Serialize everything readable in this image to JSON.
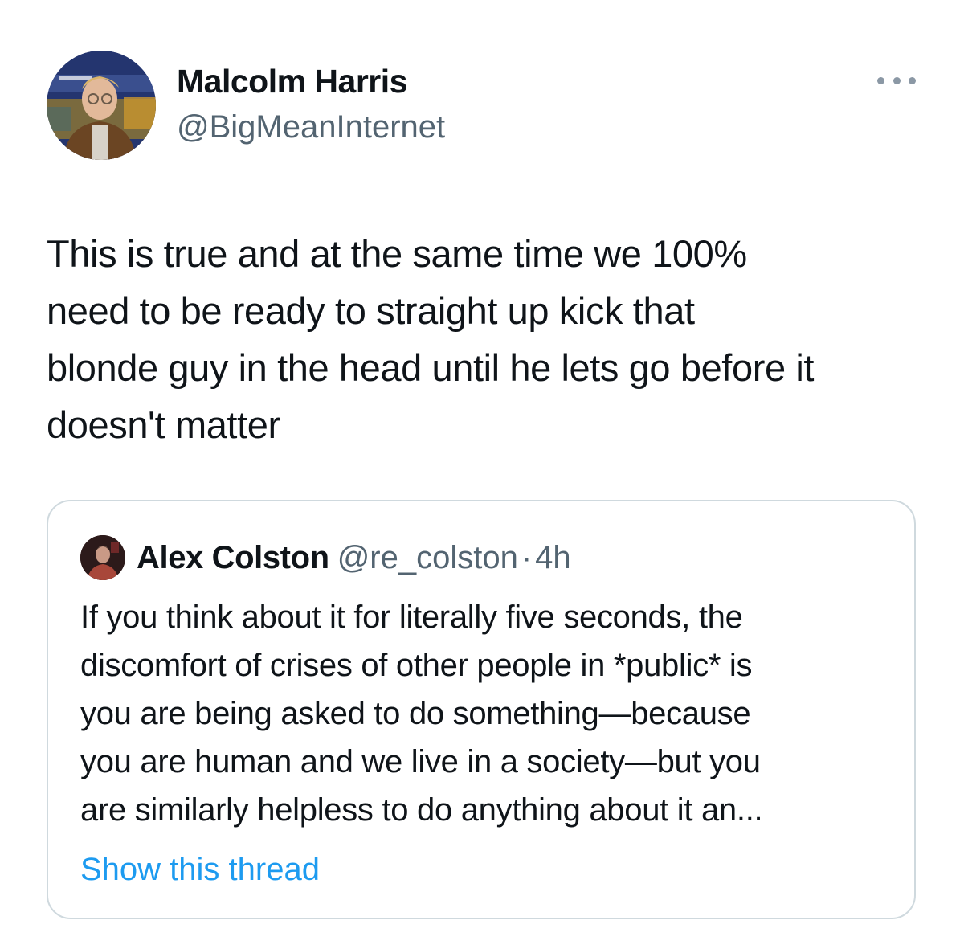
{
  "tweet": {
    "author_name": "Malcolm Harris",
    "author_handle": "@BigMeanInternet",
    "more_icon": "more-horizontal-icon",
    "text": "This is true and at the same time we 100%\nneed to be ready to straight up kick that\nblonde guy in the head until he lets go before it\ndoesn't matter"
  },
  "quote": {
    "author_name": "Alex Colston",
    "author_handle": "@re_colston",
    "separator": "·",
    "time": "4h",
    "text": "If you think about it for literally five seconds, the\ndiscomfort of crises of other people in *public* is\nyou are being asked to do something—because\nyou are human and we live in a society—but you\nare similarly helpless to do anything about it an...",
    "show_thread_label": "Show this thread"
  },
  "colors": {
    "text_primary": "#0f1419",
    "text_secondary": "#536471",
    "link": "#1d9bf0",
    "border": "#cfd9de"
  }
}
